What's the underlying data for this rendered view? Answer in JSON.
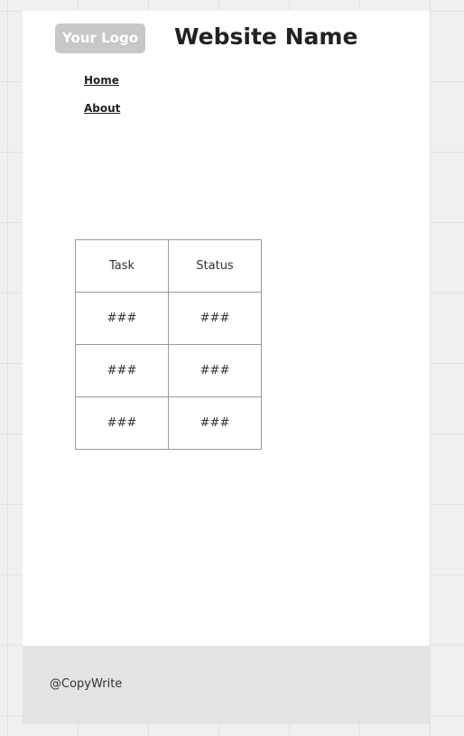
{
  "header": {
    "logo_text": "Your Logo",
    "site_name": "Website Name"
  },
  "nav": {
    "items": [
      {
        "label": "Home"
      },
      {
        "label": "About"
      }
    ]
  },
  "table": {
    "headers": [
      "Task",
      "Status"
    ],
    "rows": [
      [
        "###",
        "###"
      ],
      [
        "###",
        "###"
      ],
      [
        "###",
        "###"
      ]
    ]
  },
  "footer": {
    "copyright": "@CopyWrite"
  }
}
